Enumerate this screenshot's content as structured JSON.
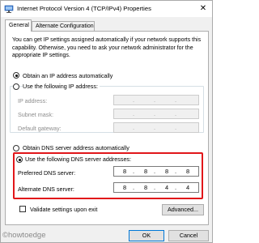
{
  "window": {
    "title": "Internet Protocol Version 4 (TCP/IPv4) Properties",
    "close_glyph": "✕"
  },
  "tabs": [
    {
      "label": "General",
      "active": true
    },
    {
      "label": "Alternate Configuration",
      "active": false
    }
  ],
  "general": {
    "description": "You can get IP settings assigned automatically if your network supports this capability. Otherwise, you need to ask your network administrator for the appropriate IP settings.",
    "ip_auto_label": "Obtain an IP address automatically",
    "ip_manual_label": "Use the following IP address:",
    "ip_address_label": "IP address:",
    "subnet_mask_label": "Subnet mask:",
    "default_gateway_label": "Default gateway:",
    "dns_auto_label": "Obtain DNS server address automatically",
    "dns_manual_label": "Use the following DNS server addresses:",
    "preferred_dns_label": "Preferred DNS server:",
    "preferred_dns_value": [
      "8",
      "8",
      "8",
      "8"
    ],
    "alternate_dns_label": "Alternate DNS server:",
    "alternate_dns_value": [
      "8",
      "8",
      "4",
      "4"
    ],
    "validate_label": "Validate settings upon exit",
    "advanced_label": "Advanced..."
  },
  "footer": {
    "ok_label": "OK",
    "cancel_label": "Cancel"
  },
  "watermark": "©howtoedge",
  "colors": {
    "highlight": "#e1161a",
    "default_button_border": "#0078d7",
    "disabled_text": "#8d8d8d"
  }
}
